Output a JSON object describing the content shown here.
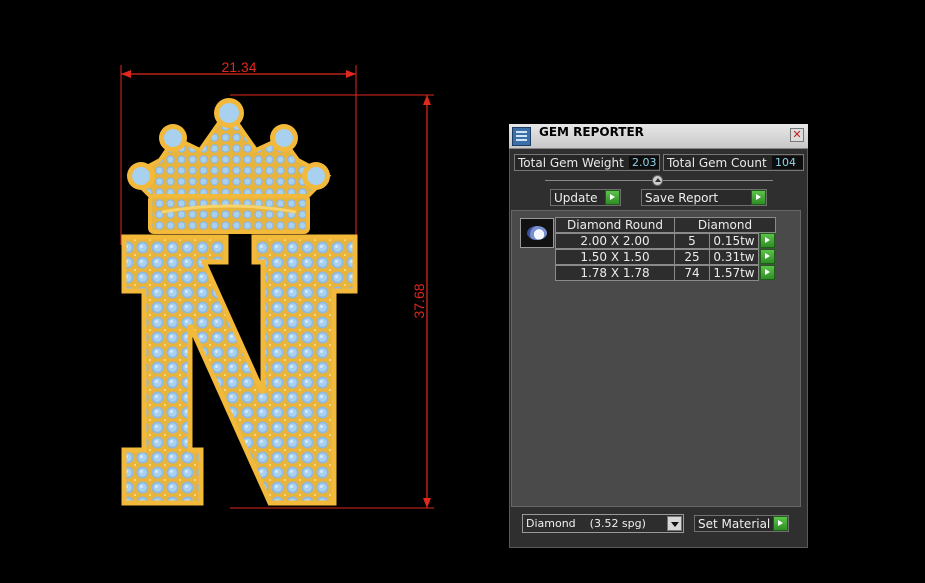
{
  "drawing": {
    "width_dimension": "21.34",
    "height_dimension": "37.68",
    "colors": {
      "dimension": "#e0281e",
      "gold": "#f2b93b",
      "stone": "#a8d0ef"
    }
  },
  "gem_reporter": {
    "title": "GEM REPORTER",
    "close_icon": "close-icon",
    "total_gem_weight_label": "Total Gem Weight",
    "total_gem_weight_value": "2.03",
    "total_gem_count_label": "Total Gem Count",
    "total_gem_count_value": "104",
    "update_label": "Update",
    "save_report_label": "Save Report",
    "table": {
      "shape_header": "Diamond Round",
      "material_header": "Diamond",
      "rows": [
        {
          "size": "2.00 X 2.00",
          "count": "5",
          "weight": "0.15tw"
        },
        {
          "size": "1.50 X 1.50",
          "count": "25",
          "weight": "0.31tw"
        },
        {
          "size": "1.78 X 1.78",
          "count": "74",
          "weight": "1.57tw"
        }
      ]
    },
    "material_select_value": "Diamond    (3.52 spg)",
    "set_material_label": "Set Material",
    "colors": {
      "go_button": "#3faa32",
      "value_text": "#8fd4e8"
    }
  }
}
